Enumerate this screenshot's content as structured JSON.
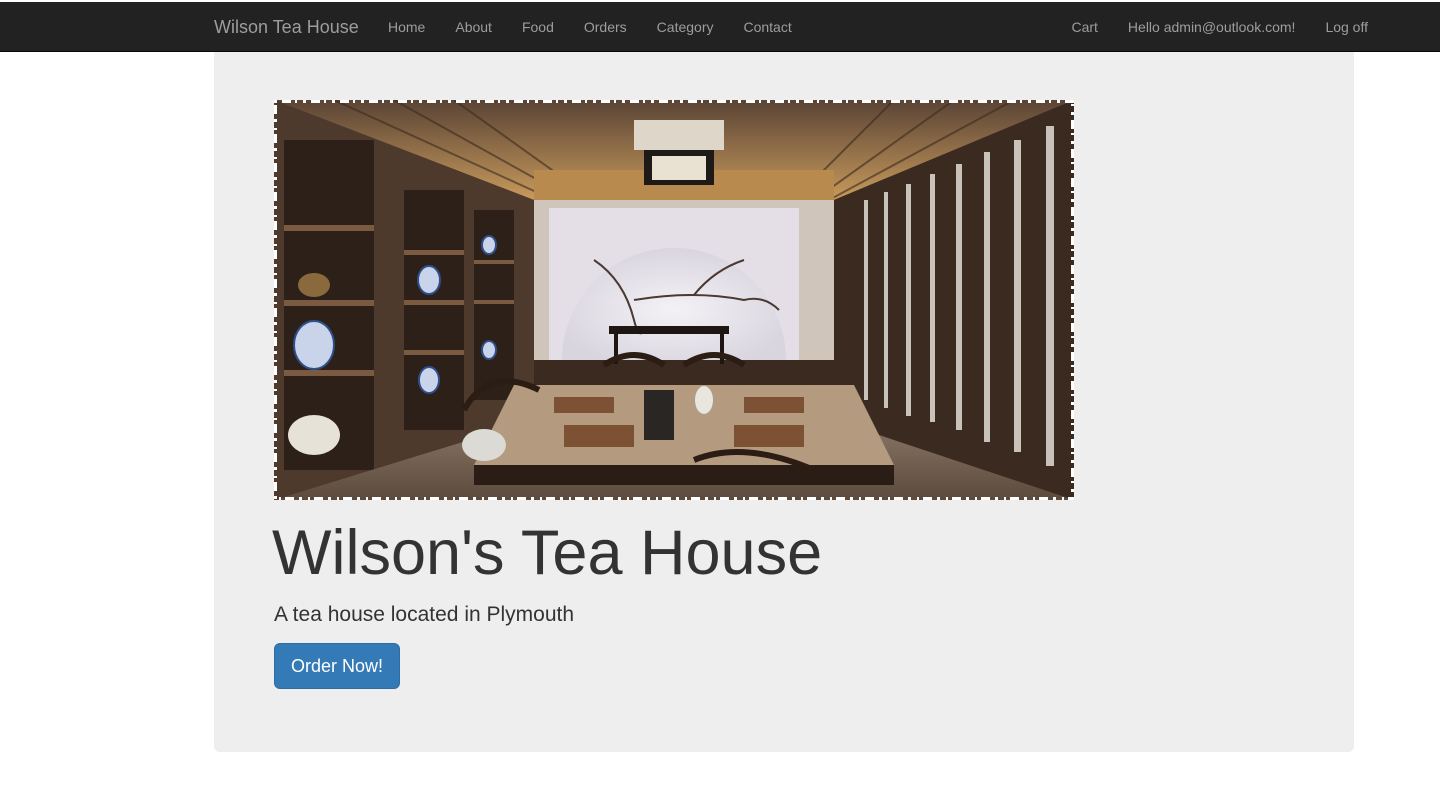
{
  "navbar": {
    "brand": "Wilson Tea House",
    "left_links": [
      "Home",
      "About",
      "Food",
      "Orders",
      "Category",
      "Contact"
    ],
    "right_links": [
      "Cart",
      "Hello admin@outlook.com!",
      "Log off"
    ]
  },
  "hero": {
    "image_icon": "tea-room-photo",
    "title": "Wilson's Tea House",
    "lead": "A tea house located in Plymouth",
    "order_button": "Order Now!"
  },
  "colors": {
    "navbar_bg": "#222222",
    "navbar_text": "#9d9d9d",
    "jumbotron_bg": "#eeeeee",
    "button_bg": "#337ab7"
  }
}
